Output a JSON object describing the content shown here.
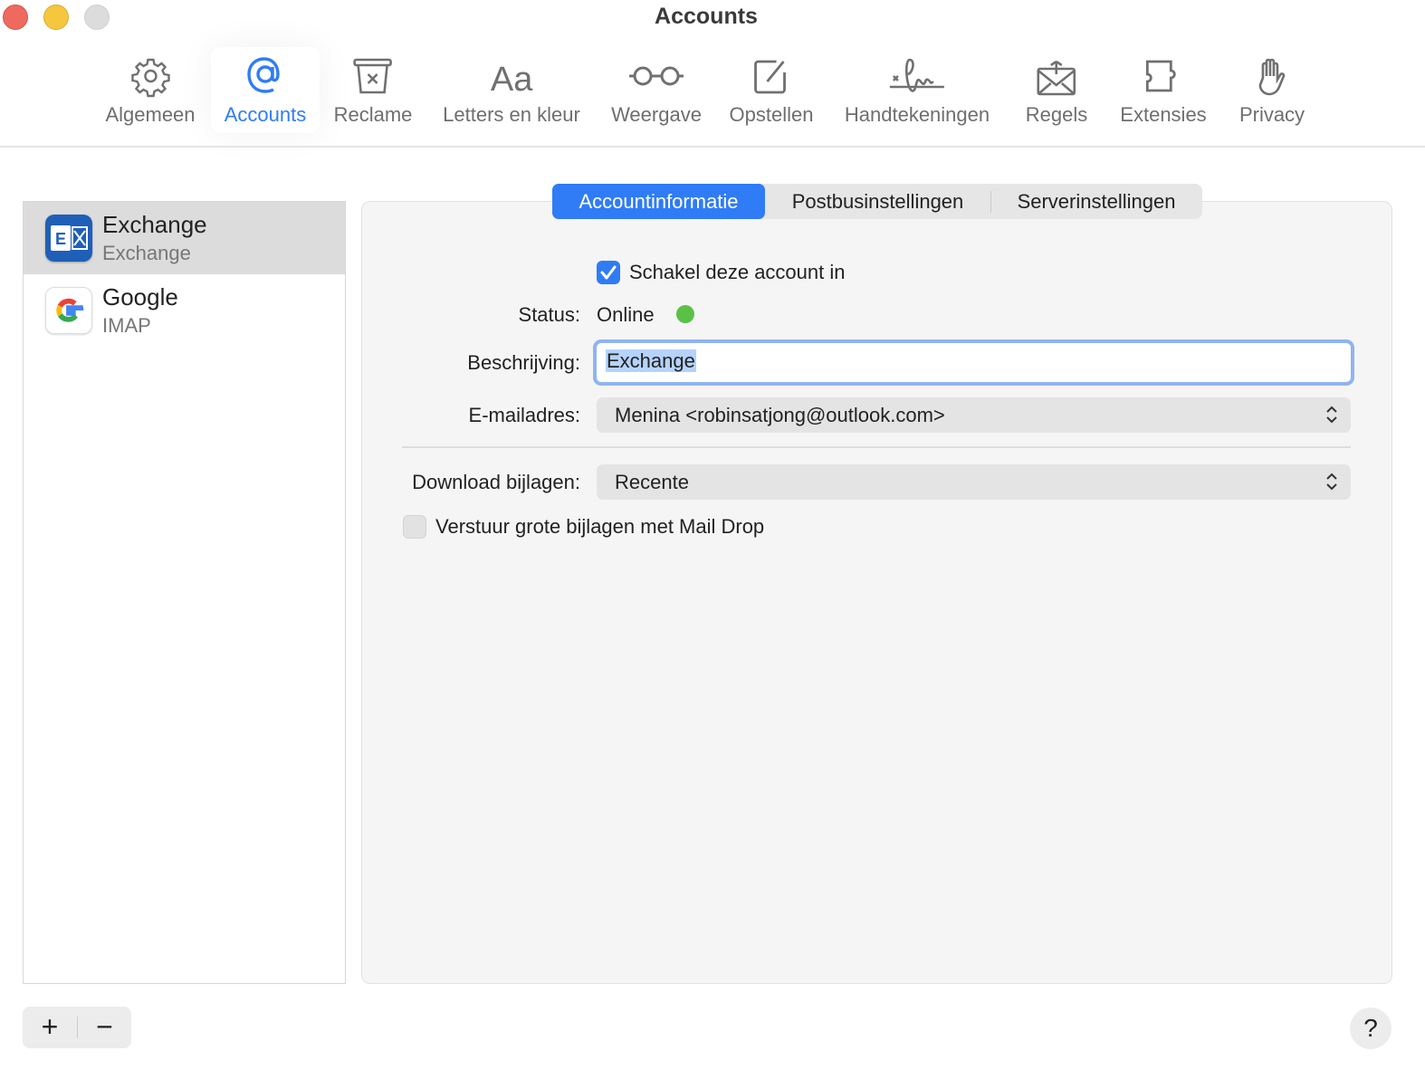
{
  "window": {
    "title": "Accounts"
  },
  "toolbar": [
    {
      "label": "Algemeen",
      "icon": "gear-icon"
    },
    {
      "label": "Accounts",
      "icon": "at-icon"
    },
    {
      "label": "Reclame",
      "icon": "junk-bin-icon"
    },
    {
      "label": "Letters en kleur",
      "icon": "fonts-icon"
    },
    {
      "label": "Weergave",
      "icon": "glasses-icon"
    },
    {
      "label": "Opstellen",
      "icon": "compose-icon"
    },
    {
      "label": "Handtekeningen",
      "icon": "signature-icon"
    },
    {
      "label": "Regels",
      "icon": "rules-envelope-icon"
    },
    {
      "label": "Extensies",
      "icon": "puzzle-icon"
    },
    {
      "label": "Privacy",
      "icon": "hand-icon"
    }
  ],
  "accounts": [
    {
      "name": "Exchange",
      "type": "Exchange"
    },
    {
      "name": "Google",
      "type": "IMAP"
    }
  ],
  "tabs": [
    "Accountinformatie",
    "Postbusinstellingen",
    "Serverinstellingen"
  ],
  "form": {
    "enable_label": "Schakel deze account in",
    "enable_checked": true,
    "status_label": "Status:",
    "status_value": "Online",
    "status_color": "#5ac146",
    "description_label": "Beschrijving:",
    "description_value": "Exchange",
    "email_label": "E-mailadres:",
    "email_value": "Menina <robinsatjong@outlook.com>",
    "download_label": "Download bijlagen:",
    "download_value": "Recente",
    "maildrop_label": "Verstuur grote bijlagen met Mail Drop",
    "maildrop_checked": false
  },
  "footer": {
    "add": "+",
    "remove": "−",
    "help": "?"
  }
}
